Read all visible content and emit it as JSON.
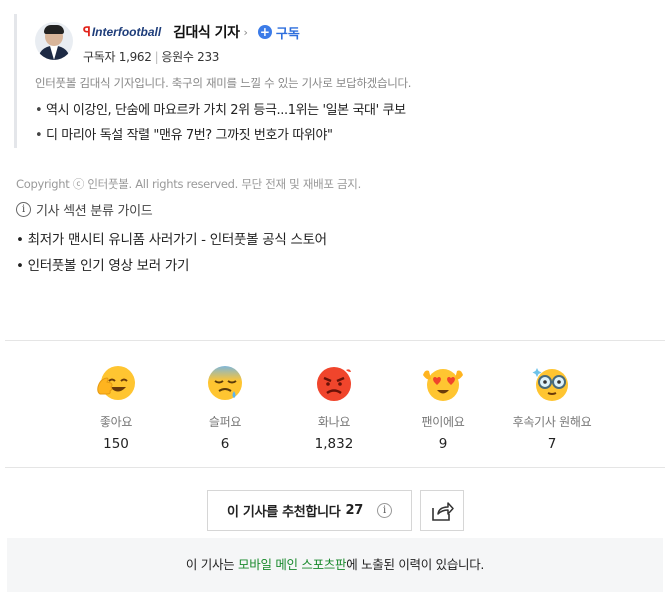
{
  "reporter": {
    "outlet_logo": "Interfootball",
    "name": "김대식 기자",
    "subscribe_label": "구독",
    "subscribers_label": "구독자",
    "subscribers": "1,962",
    "cheers_label": "응원수",
    "cheers": "233",
    "description": "인터풋볼 김대식 기자입니다. 축구의 재미를 느낄 수 있는 기사로 보답하겠습니다.",
    "articles": [
      "역시 이강인, 단숨에 마요르카 가치 2위 등극...1위는 '일본 국대' 쿠보",
      "디 마리아 독설 작렬 \"맨유 7번? 그까짓 번호가 따위야\""
    ]
  },
  "footer": {
    "copyright": "Copyright ⓒ 인터풋볼. All rights reserved. 무단 전재 및 재배포 금지.",
    "guide": "기사 섹션 분류 가이드",
    "promos": [
      "최저가 맨시티 유니폼 사러가기 - 인터풋볼 공식 스토어",
      "인터풋볼 인기 영상 보러 가기"
    ]
  },
  "reactions": [
    {
      "label": "좋아요",
      "count": "150",
      "icon": "like-emoji-icon"
    },
    {
      "label": "슬퍼요",
      "count": "6",
      "icon": "sad-emoji-icon"
    },
    {
      "label": "화나요",
      "count": "1,832",
      "icon": "angry-emoji-icon"
    },
    {
      "label": "팬이에요",
      "count": "9",
      "icon": "fan-emoji-icon"
    },
    {
      "label": "후속기사 원해요",
      "count": "7",
      "icon": "want-more-emoji-icon"
    }
  ],
  "recommend": {
    "label": "이 기사를 추천합니다",
    "count": "27",
    "info_icon": "info-icon",
    "share_icon": "share-icon"
  },
  "notice": {
    "prefix": "이 기사는 ",
    "highlight": "모바일 메인 스포츠판",
    "suffix": "에 노출된 이력이 있습니다."
  },
  "colors": {
    "accent_blue": "#3b7be8",
    "notice_green": "#1b8a2e",
    "logo_red": "#e2231a"
  }
}
